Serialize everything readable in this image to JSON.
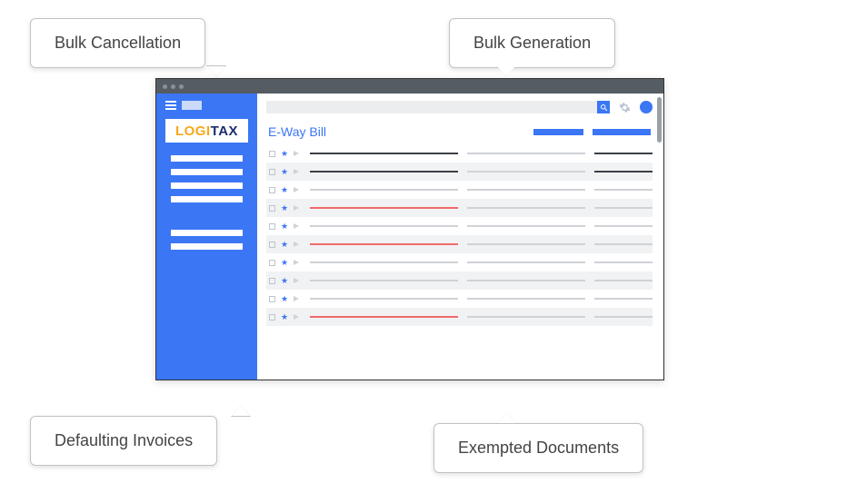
{
  "callouts": {
    "bulk_cancellation": "Bulk Cancellation",
    "bulk_generation": "Bulk Generation",
    "defaulting_invoices": "Defaulting Invoices",
    "exempted_documents": "Exempted Documents"
  },
  "logo": {
    "part1": "LOGI",
    "part2": "TAX"
  },
  "page_title": "E-Way Bill",
  "rows": [
    {
      "style": "dark"
    },
    {
      "style": "dark"
    },
    {
      "style": "grey"
    },
    {
      "style": "red"
    },
    {
      "style": "grey"
    },
    {
      "style": "red"
    },
    {
      "style": "grey"
    },
    {
      "style": "grey"
    },
    {
      "style": "grey"
    },
    {
      "style": "red"
    }
  ]
}
